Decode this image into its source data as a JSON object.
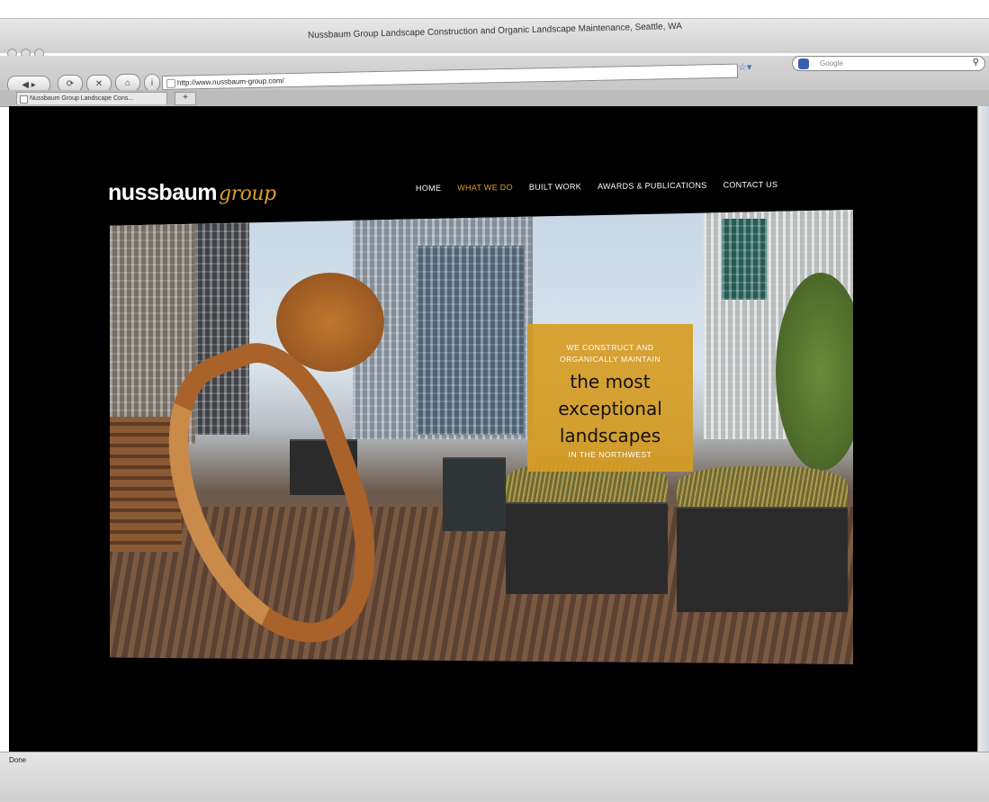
{
  "browser": {
    "window_title": "Nussbaum Group Landscape Construction and Organic Landscape Maintenance, Seattle, WA",
    "url": "http://www.nussbaum-group.com/",
    "search_placeholder": "Google",
    "tab_title": "Nussbaum Group Landscape Cons...",
    "new_tab_label": "+",
    "status": "Done"
  },
  "site": {
    "logo_main": "nussbaum",
    "logo_accent": "group",
    "accent_color": "#d9a027",
    "nav": [
      {
        "label": "HOME",
        "active": false
      },
      {
        "label": "WHAT WE DO",
        "active": true
      },
      {
        "label": "BUILT WORK",
        "active": false
      },
      {
        "label": "AWARDS & PUBLICATIONS",
        "active": false
      },
      {
        "label": "CONTACT US",
        "active": false
      }
    ],
    "callout": {
      "line1": "WE CONSTRUCT AND",
      "line2": "ORGANICALLY MAINTAIN",
      "big1": "the most",
      "big2": "exceptional",
      "big3": "landscapes",
      "line3": "IN THE NORTHWEST"
    }
  }
}
